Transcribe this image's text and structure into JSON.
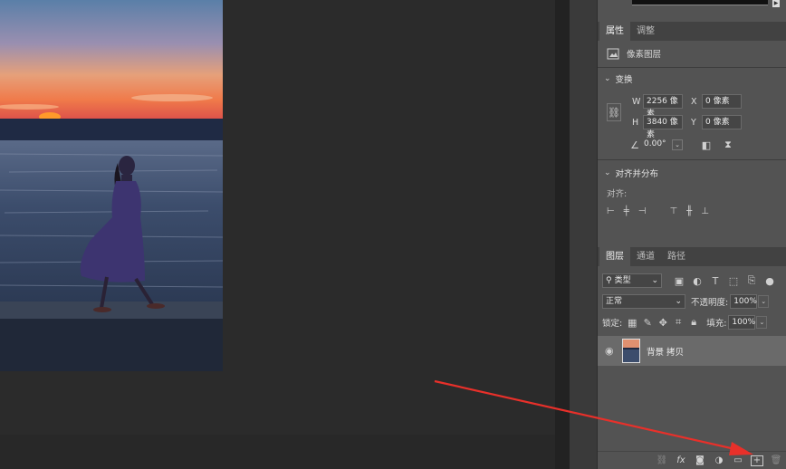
{
  "properties_panel": {
    "tabs": [
      "属性",
      "调整"
    ],
    "layer_kind": "像素图层",
    "transform": {
      "title": "变换",
      "w_label": "W",
      "w_value": "2256 像素",
      "h_label": "H",
      "h_value": "3840 像素",
      "x_label": "X",
      "x_value": "0 像素",
      "y_label": "Y",
      "y_value": "0 像素",
      "angle_value": "0.00°"
    },
    "align": {
      "title": "对齐并分布",
      "label": "对齐:"
    }
  },
  "layers_panel": {
    "tabs": [
      "图层",
      "通道",
      "路径"
    ],
    "filter_kind": "类型",
    "blend_mode": "正常",
    "opacity_label": "不透明度:",
    "opacity_value": "100%",
    "lock_label": "锁定:",
    "fill_label": "填充:",
    "fill_value": "100%",
    "layers": [
      {
        "name": "背景 拷贝",
        "visible": true
      }
    ],
    "bottom_icons": [
      "link-icon",
      "fx-icon",
      "mask-icon",
      "adjustment-icon",
      "group-folder-icon",
      "new-layer-icon",
      "trash-icon"
    ],
    "bottom_fx_label": "fx"
  },
  "annotation": {
    "arrow_color": "#e8302a",
    "points_to": "new-layer-icon"
  },
  "colors": {
    "panel_bg": "#535353",
    "canvas_bg": "#2b2b2b",
    "selected_layer": "#6a6a6a"
  }
}
